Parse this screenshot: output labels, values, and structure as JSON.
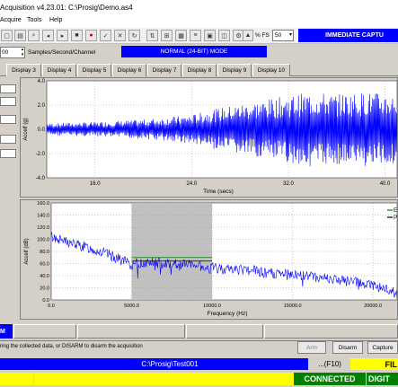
{
  "window": {
    "title": "Acquisition v4.23.01: C:\\Prosig\\Demo.as4"
  },
  "menu": {
    "items": [
      "Acquire",
      "Tools",
      "Help"
    ]
  },
  "toolbar": {
    "pct_label": "% FS",
    "pct_value": "50",
    "immediate_label": "IMMEDIATE CAPTU"
  },
  "acquisition": {
    "sample_rate": "00",
    "sample_rate_label": "Samples/Second/Channel",
    "mode": "NORMAL (24-BIT) MODE"
  },
  "tabs": [
    "Display 3",
    "Display 4",
    "Display 5",
    "Display 6",
    "Display 7",
    "Display 8",
    "Display 9",
    "Display 10"
  ],
  "left_panel": {
    "values": [
      "",
      "",
      "",
      "",
      ""
    ]
  },
  "time_plot": {
    "ylabel": "Accelf (g)",
    "xlabel": "Time (secs)",
    "yticks": [
      "4.0",
      "2.0",
      "0.0",
      "-2.0",
      "-4.0"
    ],
    "xticks": [
      "16.0",
      "24.0",
      "32.0",
      "40.0"
    ]
  },
  "freq_plot": {
    "ylabel": "Accelf (dB)",
    "xlabel": "Frequency (Hz)",
    "yticks": [
      "160.0",
      "140.0",
      "120.0",
      "100.0",
      "80.0",
      "60.0",
      "40.0",
      "20.0",
      "0.0"
    ],
    "xticks": [
      "0.0",
      "5000.0",
      "10000.0",
      "15000.0",
      "20000.0"
    ],
    "legend": [
      "E",
      "P"
    ]
  },
  "status": {
    "arm_strip": "M",
    "hint": "ring the collected data, or DISARM to disarm the acquisition",
    "arm_label": "Arm",
    "disarm_label": "Disarm",
    "capture_label": "Capture"
  },
  "filebar": {
    "path": "C:\\Prosig\\Test001",
    "f10": "...(F10)",
    "fil": "FIL"
  },
  "bottom": {
    "connected": "CONNECTED",
    "digit": "DIGIT"
  },
  "colors": {
    "accent": "#0000ff",
    "signal": "#0000ff",
    "highlight": "#ffff00",
    "ok": "#008000"
  },
  "chart_data": [
    {
      "type": "line",
      "xlabel": "Time (secs)",
      "ylabel": "Accelf (g)",
      "xlim": [
        12.0,
        41.0
      ],
      "ylim": [
        -4.0,
        4.0
      ],
      "grid": true,
      "series": [
        {
          "envelope_x": [
            12,
            16,
            20,
            24,
            26,
            28,
            30,
            32,
            34,
            36,
            38,
            40,
            41
          ],
          "envelope_amplitude": [
            0.5,
            0.6,
            0.8,
            1.2,
            1.7,
            2.1,
            2.4,
            2.8,
            3.1,
            2.9,
            3.1,
            3.0,
            2.9
          ]
        }
      ]
    },
    {
      "type": "line",
      "xlabel": "Frequency (Hz)",
      "ylabel": "Accelf (dB)",
      "xlim": [
        0,
        21500
      ],
      "ylim": [
        0.0,
        160.0
      ],
      "grid": true,
      "legend": "top-right",
      "series": [
        {
          "x": [
            0,
            1000,
            2000,
            3000,
            4000,
            5000,
            6000,
            8000,
            10000,
            12000,
            14000,
            16000,
            18000,
            20000,
            21500
          ],
          "y": [
            105,
            95,
            88,
            80,
            70,
            58,
            62,
            60,
            52,
            50,
            42,
            40,
            32,
            25,
            10
          ]
        }
      ],
      "band": {
        "x_range": [
          5000,
          10000
        ],
        "y_range": [
          0,
          160
        ],
        "level": 70
      }
    }
  ]
}
